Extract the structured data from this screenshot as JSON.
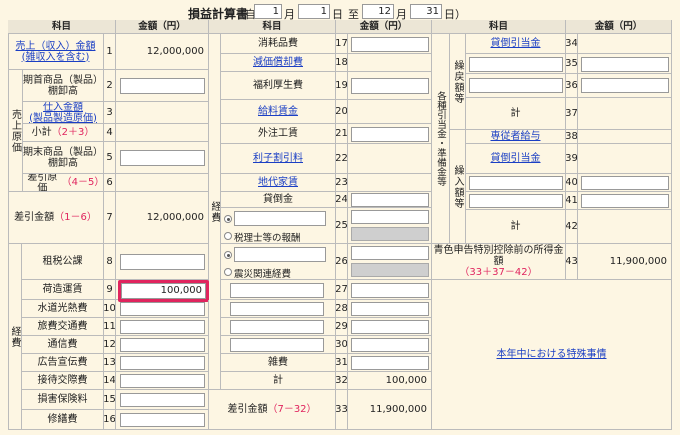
{
  "header": {
    "title": "損益計算書",
    "open_paren": "（自",
    "start_month": "1",
    "month_label": "月",
    "start_day": "1",
    "day_label": "日",
    "to_label": "至",
    "end_month": "12",
    "end_day": "31",
    "close_day_label": "日）"
  },
  "columns": {
    "item": "科目",
    "amount": "金額（円）"
  },
  "left": {
    "sales": {
      "label": "売上（収入）金額\n(雑収入を含む)",
      "no": "1",
      "value": "12,000,000"
    },
    "cogs_group": "売上原価",
    "opening": {
      "label": "期首商品（製品）棚卸高",
      "no": "2"
    },
    "purchases": {
      "label": "仕入金額\n(製品製造原価)",
      "no": "3"
    },
    "subtotal": {
      "label": "小計",
      "formula": "（2＋3）",
      "no": "4"
    },
    "closing": {
      "label": "期末商品（製品）棚卸高",
      "no": "5"
    },
    "cogs": {
      "label": "差引原価",
      "formula": "（4－5）",
      "no": "6"
    },
    "gross": {
      "label": "差引金額",
      "formula": "（1－6）",
      "no": "7",
      "value": "12,000,000"
    },
    "expense_group": "経費",
    "taxes": {
      "label": "租税公課",
      "no": "8"
    },
    "packing": {
      "label": "荷造運賃",
      "no": "9",
      "value": "100,000"
    },
    "utilities": {
      "label": "水道光熱費",
      "no": "10"
    },
    "travel": {
      "label": "旅費交通費",
      "no": "11"
    },
    "communication": {
      "label": "通信費",
      "no": "12"
    },
    "advertising": {
      "label": "広告宣伝費",
      "no": "13"
    },
    "entertainment": {
      "label": "接待交際費",
      "no": "14"
    },
    "insurance": {
      "label": "損害保険料",
      "no": "15"
    },
    "repairs": {
      "label": "修繕費",
      "no": "16"
    }
  },
  "middle": {
    "expense_group": "経費",
    "supplies": {
      "label": "消耗品費",
      "no": "17"
    },
    "depreciation": {
      "label": "減価償却費",
      "no": "18"
    },
    "welfare": {
      "label": "福利厚生費",
      "no": "19"
    },
    "wages": {
      "label": "給料賃金",
      "no": "20"
    },
    "outsourcing": {
      "label": "外注工賃",
      "no": "21"
    },
    "interest": {
      "label": "利子割引料",
      "no": "22"
    },
    "rent": {
      "label": "地代家賃",
      "no": "23"
    },
    "bad_debt": {
      "label": "貸倒金",
      "no": "24"
    },
    "row25": {
      "no": "25",
      "radio_label": "税理士等の報酬"
    },
    "row26": {
      "no": "26",
      "radio_label": "震災関連経費"
    },
    "row27": {
      "no": "27"
    },
    "row28": {
      "no": "28"
    },
    "row29": {
      "no": "29"
    },
    "row30": {
      "no": "30"
    },
    "misc": {
      "label": "雑費",
      "no": "31"
    },
    "total": {
      "label": "計",
      "no": "32",
      "value": "100,000"
    },
    "net": {
      "label": "差引金額",
      "formula": "（7－32）",
      "no": "33",
      "value": "11,900,000"
    }
  },
  "right": {
    "reserves_group": "各種引当金・準備金等",
    "reversal_group": "繰戻額等",
    "transfer_group": "繰入額等",
    "bad_debt_reversal": {
      "label": "貸倒引当金",
      "no": "34"
    },
    "row35": {
      "no": "35"
    },
    "row36": {
      "no": "36"
    },
    "subtotal37": {
      "label": "計",
      "no": "37"
    },
    "family_wages": {
      "label": "専従者給与",
      "no": "38"
    },
    "bad_debt_transfer": {
      "label": "貸倒引当金",
      "no": "39"
    },
    "row40": {
      "no": "40"
    },
    "row41": {
      "no": "41"
    },
    "subtotal42": {
      "label": "計",
      "no": "42"
    },
    "blue_income": {
      "label": "青色申告特別控除前の所得金額",
      "formula": "（33＋37－42）",
      "no": "43",
      "value": "11,900,000"
    },
    "special_link": "本年中における特殊事情"
  }
}
